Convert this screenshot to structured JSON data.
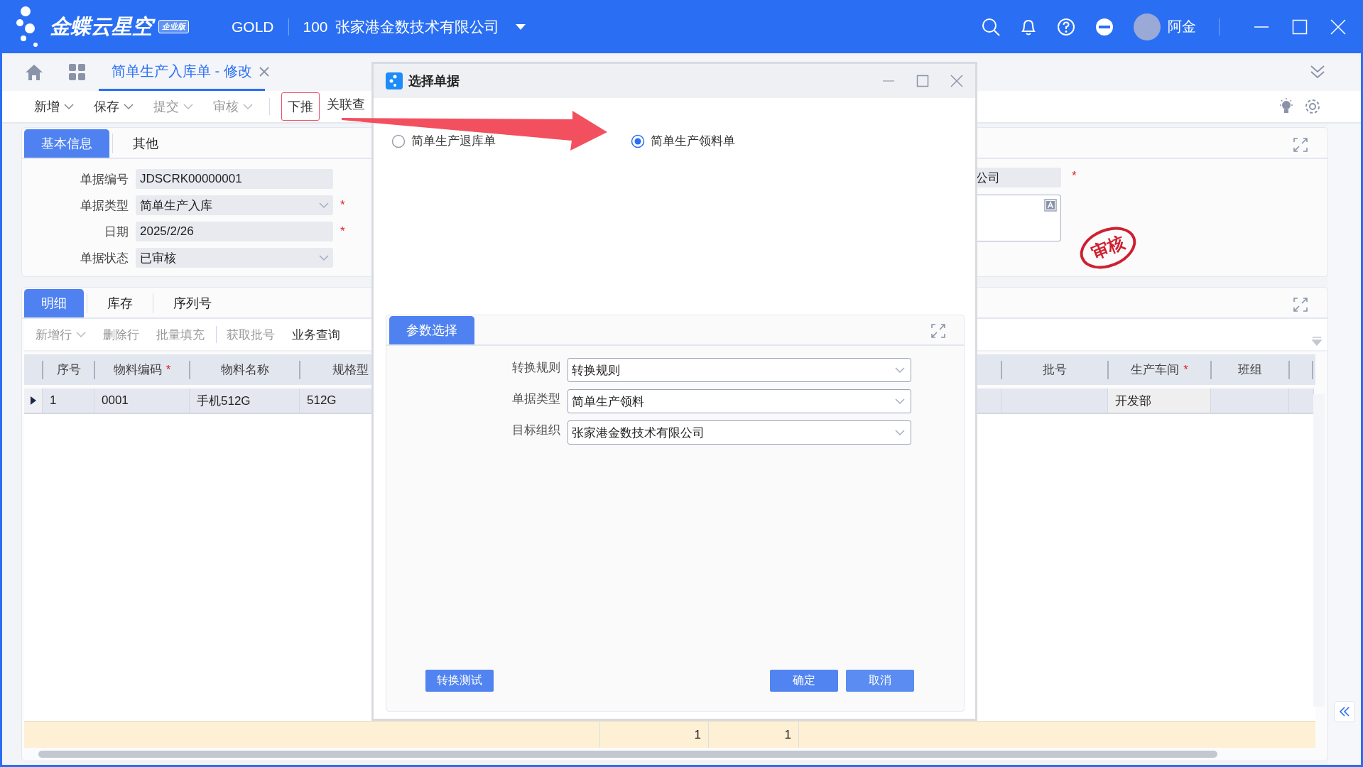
{
  "app": {
    "logo_text": "金蝶云星空",
    "edition": "企业版",
    "data_center": "GOLD",
    "org_code": "100",
    "org_name": "张家港金数技术有限公司",
    "user": "阿金"
  },
  "doc_tabs": [
    {
      "label": "简单生产入库单 - 修改",
      "selected": true
    }
  ],
  "toolbar": [
    {
      "label": "新增",
      "dropdown": true,
      "disabled": false,
      "highlighted": false
    },
    {
      "label": "保存",
      "dropdown": true,
      "disabled": false,
      "highlighted": false
    },
    {
      "label": "提交",
      "dropdown": true,
      "disabled": true,
      "highlighted": false
    },
    {
      "label": "审核",
      "dropdown": true,
      "disabled": true,
      "highlighted": false
    },
    {
      "label": "下推",
      "dropdown": false,
      "disabled": false,
      "highlighted": true
    },
    {
      "label": "关联查",
      "dropdown": false,
      "disabled": false,
      "highlighted": false
    }
  ],
  "header_form": {
    "tabs": [
      {
        "label": "基本信息",
        "selected": true
      },
      {
        "label": "其他",
        "selected": false
      }
    ],
    "fields": [
      {
        "label": "单据编号",
        "value": "JDSCRK00000001",
        "kind": "text"
      },
      {
        "label": "单据类型",
        "value": "简单生产入库",
        "kind": "select",
        "required_mark": "*"
      },
      {
        "label": "日期",
        "value": "2025/2/26",
        "kind": "text",
        "required_mark": "*"
      },
      {
        "label": "单据状态",
        "value": "已审核",
        "kind": "select"
      }
    ],
    "right_field": {
      "value": "公司",
      "required_mark": "*"
    },
    "stamp": "审核"
  },
  "detail": {
    "tabs": [
      {
        "label": "明细",
        "selected": true
      },
      {
        "label": "库存",
        "selected": false
      },
      {
        "label": "序列号",
        "selected": false
      }
    ],
    "toolbar": [
      {
        "label": "新增行",
        "dropdown": true,
        "disabled": true
      },
      {
        "label": "删除行",
        "dropdown": false,
        "disabled": true
      },
      {
        "label": "批量填充",
        "dropdown": false,
        "disabled": true
      },
      {
        "label": "获取批号",
        "dropdown": false,
        "disabled": true
      },
      {
        "label": "业务查询",
        "dropdown": false,
        "disabled": false
      }
    ],
    "columns": [
      {
        "label": "序号"
      },
      {
        "label": "物料编码",
        "required_mark": "*"
      },
      {
        "label": "物料名称"
      },
      {
        "label": "规格型"
      },
      {
        "label": "批号"
      },
      {
        "label": "生产车间",
        "required_mark": "*"
      },
      {
        "label": "班组"
      }
    ],
    "rows": [
      {
        "selected": true,
        "cells": [
          "1",
          "0001",
          "手机512G",
          "512G",
          null,
          "开发部",
          null
        ]
      }
    ],
    "totals": [
      "1",
      "1"
    ]
  },
  "dialog": {
    "title": "选择单据",
    "options": [
      {
        "label": "简单生产退库单",
        "selected": false
      },
      {
        "label": "简单生产领料单",
        "selected": true
      }
    ],
    "panel_tab": "参数选择",
    "fields": [
      {
        "label": "转换规则",
        "value": "转换规则"
      },
      {
        "label": "单据类型",
        "value": "简单生产领料"
      },
      {
        "label": "目标组织",
        "value": "张家港金数技术有限公司"
      }
    ],
    "buttons": [
      {
        "label": "转换测试",
        "kind": "test"
      },
      {
        "label": "确定",
        "kind": "confirm"
      },
      {
        "label": "取消",
        "kind": "cancel"
      }
    ]
  }
}
